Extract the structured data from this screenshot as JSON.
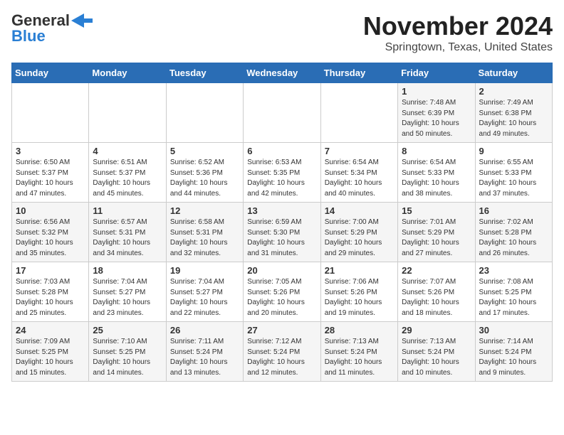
{
  "logo": {
    "line1": "General",
    "line2": "Blue"
  },
  "title": "November 2024",
  "location": "Springtown, Texas, United States",
  "weekdays": [
    "Sunday",
    "Monday",
    "Tuesday",
    "Wednesday",
    "Thursday",
    "Friday",
    "Saturday"
  ],
  "weeks": [
    [
      {
        "day": "",
        "info": ""
      },
      {
        "day": "",
        "info": ""
      },
      {
        "day": "",
        "info": ""
      },
      {
        "day": "",
        "info": ""
      },
      {
        "day": "",
        "info": ""
      },
      {
        "day": "1",
        "info": "Sunrise: 7:48 AM\nSunset: 6:39 PM\nDaylight: 10 hours\nand 50 minutes."
      },
      {
        "day": "2",
        "info": "Sunrise: 7:49 AM\nSunset: 6:38 PM\nDaylight: 10 hours\nand 49 minutes."
      }
    ],
    [
      {
        "day": "3",
        "info": "Sunrise: 6:50 AM\nSunset: 5:37 PM\nDaylight: 10 hours\nand 47 minutes."
      },
      {
        "day": "4",
        "info": "Sunrise: 6:51 AM\nSunset: 5:37 PM\nDaylight: 10 hours\nand 45 minutes."
      },
      {
        "day": "5",
        "info": "Sunrise: 6:52 AM\nSunset: 5:36 PM\nDaylight: 10 hours\nand 44 minutes."
      },
      {
        "day": "6",
        "info": "Sunrise: 6:53 AM\nSunset: 5:35 PM\nDaylight: 10 hours\nand 42 minutes."
      },
      {
        "day": "7",
        "info": "Sunrise: 6:54 AM\nSunset: 5:34 PM\nDaylight: 10 hours\nand 40 minutes."
      },
      {
        "day": "8",
        "info": "Sunrise: 6:54 AM\nSunset: 5:33 PM\nDaylight: 10 hours\nand 38 minutes."
      },
      {
        "day": "9",
        "info": "Sunrise: 6:55 AM\nSunset: 5:33 PM\nDaylight: 10 hours\nand 37 minutes."
      }
    ],
    [
      {
        "day": "10",
        "info": "Sunrise: 6:56 AM\nSunset: 5:32 PM\nDaylight: 10 hours\nand 35 minutes."
      },
      {
        "day": "11",
        "info": "Sunrise: 6:57 AM\nSunset: 5:31 PM\nDaylight: 10 hours\nand 34 minutes."
      },
      {
        "day": "12",
        "info": "Sunrise: 6:58 AM\nSunset: 5:31 PM\nDaylight: 10 hours\nand 32 minutes."
      },
      {
        "day": "13",
        "info": "Sunrise: 6:59 AM\nSunset: 5:30 PM\nDaylight: 10 hours\nand 31 minutes."
      },
      {
        "day": "14",
        "info": "Sunrise: 7:00 AM\nSunset: 5:29 PM\nDaylight: 10 hours\nand 29 minutes."
      },
      {
        "day": "15",
        "info": "Sunrise: 7:01 AM\nSunset: 5:29 PM\nDaylight: 10 hours\nand 27 minutes."
      },
      {
        "day": "16",
        "info": "Sunrise: 7:02 AM\nSunset: 5:28 PM\nDaylight: 10 hours\nand 26 minutes."
      }
    ],
    [
      {
        "day": "17",
        "info": "Sunrise: 7:03 AM\nSunset: 5:28 PM\nDaylight: 10 hours\nand 25 minutes."
      },
      {
        "day": "18",
        "info": "Sunrise: 7:04 AM\nSunset: 5:27 PM\nDaylight: 10 hours\nand 23 minutes."
      },
      {
        "day": "19",
        "info": "Sunrise: 7:04 AM\nSunset: 5:27 PM\nDaylight: 10 hours\nand 22 minutes."
      },
      {
        "day": "20",
        "info": "Sunrise: 7:05 AM\nSunset: 5:26 PM\nDaylight: 10 hours\nand 20 minutes."
      },
      {
        "day": "21",
        "info": "Sunrise: 7:06 AM\nSunset: 5:26 PM\nDaylight: 10 hours\nand 19 minutes."
      },
      {
        "day": "22",
        "info": "Sunrise: 7:07 AM\nSunset: 5:26 PM\nDaylight: 10 hours\nand 18 minutes."
      },
      {
        "day": "23",
        "info": "Sunrise: 7:08 AM\nSunset: 5:25 PM\nDaylight: 10 hours\nand 17 minutes."
      }
    ],
    [
      {
        "day": "24",
        "info": "Sunrise: 7:09 AM\nSunset: 5:25 PM\nDaylight: 10 hours\nand 15 minutes."
      },
      {
        "day": "25",
        "info": "Sunrise: 7:10 AM\nSunset: 5:25 PM\nDaylight: 10 hours\nand 14 minutes."
      },
      {
        "day": "26",
        "info": "Sunrise: 7:11 AM\nSunset: 5:24 PM\nDaylight: 10 hours\nand 13 minutes."
      },
      {
        "day": "27",
        "info": "Sunrise: 7:12 AM\nSunset: 5:24 PM\nDaylight: 10 hours\nand 12 minutes."
      },
      {
        "day": "28",
        "info": "Sunrise: 7:13 AM\nSunset: 5:24 PM\nDaylight: 10 hours\nand 11 minutes."
      },
      {
        "day": "29",
        "info": "Sunrise: 7:13 AM\nSunset: 5:24 PM\nDaylight: 10 hours\nand 10 minutes."
      },
      {
        "day": "30",
        "info": "Sunrise: 7:14 AM\nSunset: 5:24 PM\nDaylight: 10 hours\nand 9 minutes."
      }
    ]
  ]
}
